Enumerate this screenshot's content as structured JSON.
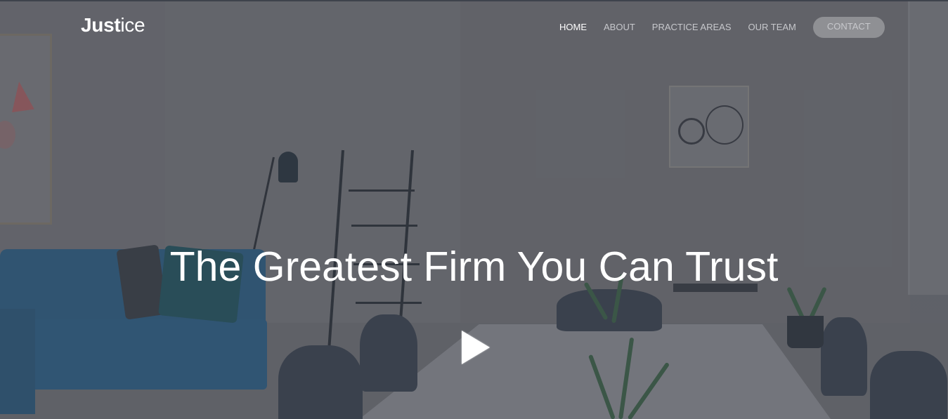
{
  "header": {
    "logo_bold": "Just",
    "logo_light": "ice",
    "nav": [
      {
        "label": "HOME",
        "active": true
      },
      {
        "label": "ABOUT",
        "active": false
      },
      {
        "label": "PRACTICE AREAS",
        "active": false
      },
      {
        "label": "OUR TEAM",
        "active": false
      }
    ],
    "contact_label": "CONTACT"
  },
  "hero": {
    "headline": "The Greatest Firm You Can Trust",
    "play_icon": "play-icon"
  },
  "colors": {
    "text": "#ffffff",
    "nav_inactive": "#c7c8cc",
    "contact_bg": "#8f9094",
    "sofa": "#1e5680"
  }
}
